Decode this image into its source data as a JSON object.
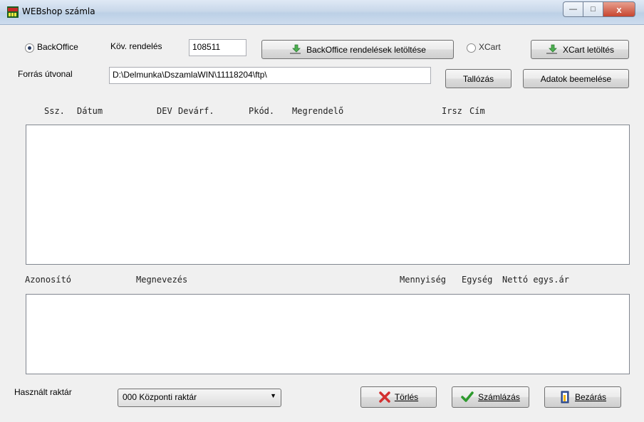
{
  "window": {
    "title": "WEBshop számla",
    "controls": {
      "minimize": "—",
      "maximize": "□",
      "close": "x"
    }
  },
  "source": {
    "backoffice_radio": "BackOffice",
    "kov_rendeles_label": "Köv. rendelés",
    "kov_rendeles_value": "108511",
    "backoffice_download": "BackOffice rendelések letöltése",
    "xcart_radio": "XCart",
    "xcart_download": "XCart letöltés",
    "path_label": "Forrás útvonal",
    "path_value": "D:\\Delmunka\\DszamlaWIN\\11118204\\ftp\\",
    "browse": "Tallózás",
    "import": "Adatok beemelése"
  },
  "orders": {
    "headers": [
      "Ssz.",
      "Dátum",
      "DEV",
      "Devárf.",
      "Pkód.",
      "Megrendelő",
      "Irsz",
      "Cím"
    ]
  },
  "items": {
    "headers": [
      "Azonosító",
      "Megnevezés",
      "Mennyiség",
      "Egység",
      "Nettó egys.ár"
    ]
  },
  "footer": {
    "warehouse_label": "Használt raktár",
    "warehouse_value": "000 Központi raktár",
    "delete": "Törlés",
    "invoice": "Számlázás",
    "close": "Bezárás"
  },
  "icons": {
    "app": "app-icon",
    "download": "download-arrow-icon",
    "delete": "red-x-icon",
    "invoice": "green-check-icon",
    "close": "door-exit-icon"
  }
}
